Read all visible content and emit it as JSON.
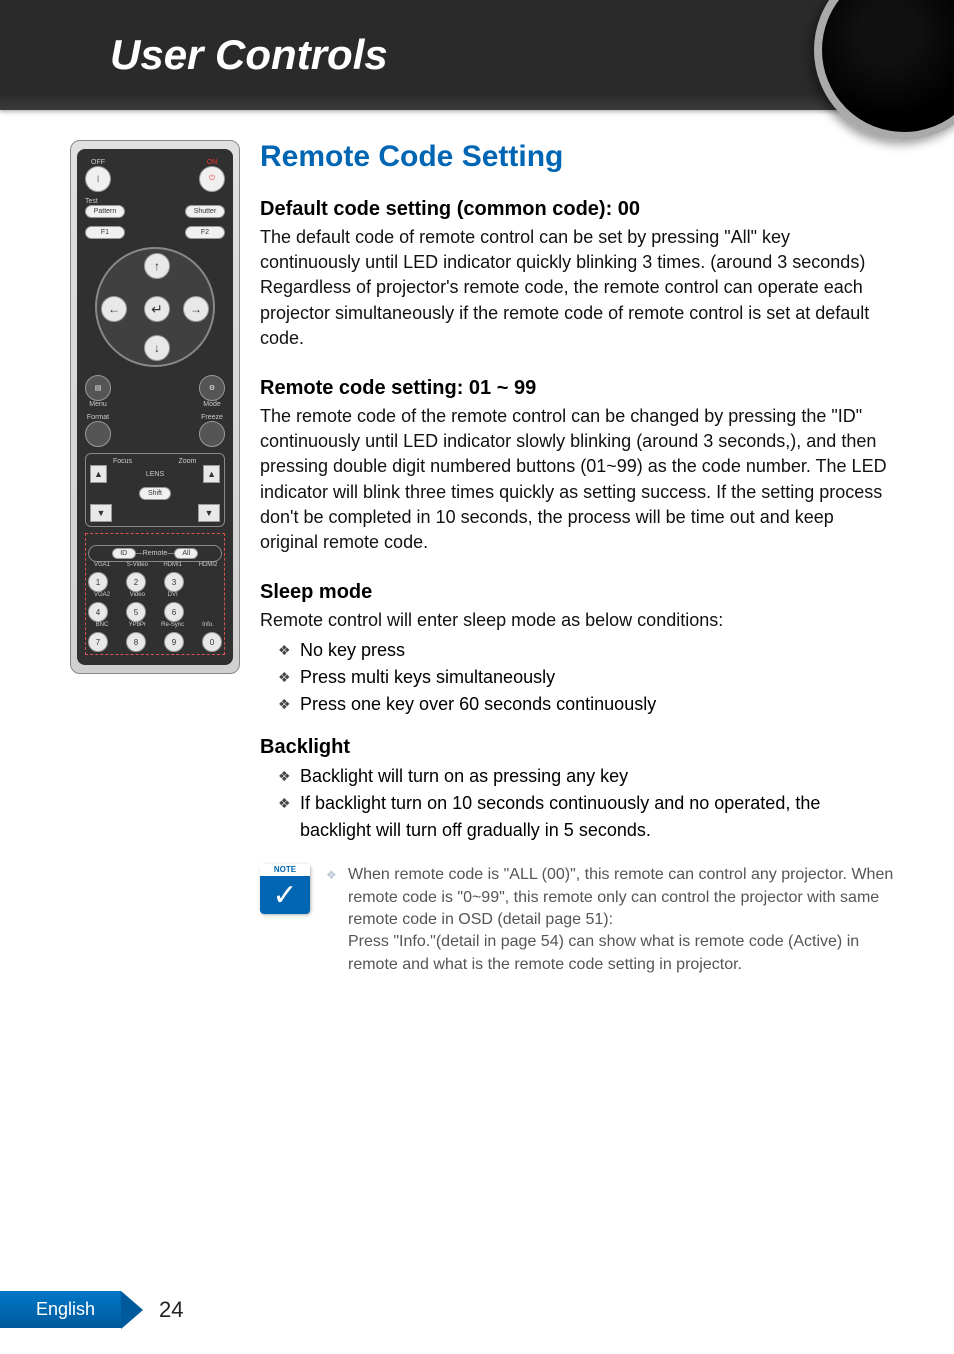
{
  "header": {
    "title": "User Controls"
  },
  "page": {
    "section_title": "Remote Code Setting",
    "default_code": {
      "heading": "Default code setting (common code): 00",
      "body": "The default code of remote control can be set by pressing \"All\" key continuously until LED indicator quickly blinking 3 times. (around 3 seconds) Regardless of projector's remote code, the remote control can operate each projector simultaneously if the remote code of remote control is set at default code."
    },
    "remote_code": {
      "heading": "Remote code setting: 01 ~ 99",
      "body": "The remote code of the remote control can be changed by pressing the \"ID\" continuously until LED indicator slowly blinking (around 3 seconds,), and then pressing double digit numbered buttons (01~99) as the code number. The LED indicator will blink three times quickly as setting success.  If  the setting process don't be completed in 10 seconds, the process will be time out and keep original remote code."
    },
    "sleep_mode": {
      "heading": "Sleep mode",
      "intro": "Remote control will enter sleep mode as below conditions:",
      "items": [
        "No key press",
        "Press multi keys simultaneously",
        "Press one key over 60 seconds continuously"
      ]
    },
    "backlight": {
      "heading": "Backlight",
      "items": [
        "Backlight will turn on as pressing any key",
        "If backlight turn on 10 seconds continuously and no operated, the backlight will turn off gradually in 5 seconds."
      ]
    },
    "note": {
      "line1": "When remote code is \"ALL (00)\", this remote can control any projector. When remote code is \"0~99\", this remote only can control the projector with same remote code in OSD (detail page 51):",
      "line2": "Press \"Info.\"(detail in page 54) can show what is remote code (Active) in remote and what is the remote code setting in projector."
    }
  },
  "remote": {
    "off": "OFF",
    "on": "ON",
    "test": "Test",
    "pattern": "Pattern",
    "shutter": "Shutter",
    "f1": "F1",
    "f2": "F2",
    "menu": "Menu",
    "mode": "Mode",
    "format": "Format",
    "freeze": "Freeze",
    "focus": "Focus",
    "zoom": "Zoom",
    "lens": "LENS",
    "shift": "Shift",
    "id": "ID",
    "remote_text": "—Remote—",
    "all": "All",
    "labels_row1": [
      "VGA1",
      "S-Video",
      "HDMI1",
      "HDMI2"
    ],
    "labels_row2": [
      "VGA2",
      "Video",
      "DVI",
      ""
    ],
    "labels_row3": [
      "BNC",
      "YPbPr",
      "Re-Sync",
      "Info."
    ],
    "nums_row1": [
      "1",
      "2",
      "3"
    ],
    "nums_row2": [
      "4",
      "5",
      "6"
    ],
    "nums_row3": [
      "7",
      "8",
      "9",
      "0"
    ]
  },
  "footer": {
    "language": "English",
    "page_number": "24"
  }
}
